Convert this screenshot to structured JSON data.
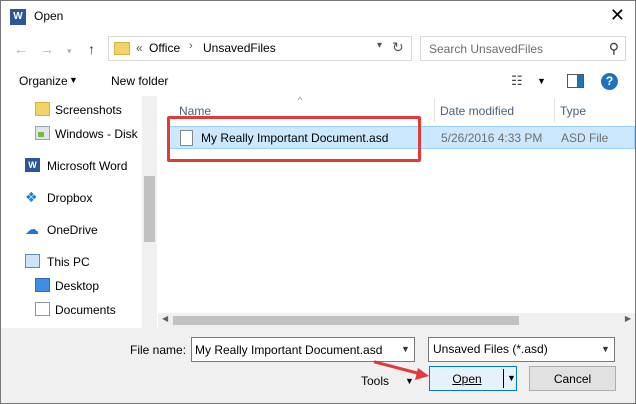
{
  "window": {
    "title": "Open",
    "app_icon": "W"
  },
  "address": {
    "chevron": "«",
    "crumbs": [
      "Office",
      "UnsavedFiles"
    ],
    "separator": "›"
  },
  "search": {
    "placeholder": "Search UnsavedFiles"
  },
  "toolbar": {
    "organize_label": "Organize",
    "new_folder_label": "New folder",
    "help": "?"
  },
  "sidebar": {
    "items": [
      {
        "label": "Screenshots",
        "icon": "folder-icon"
      },
      {
        "label": "Windows - Disk",
        "icon": "disk-icon"
      },
      {
        "label": "Microsoft Word",
        "icon": "word-icon"
      },
      {
        "label": "Dropbox",
        "icon": "dropbox-icon"
      },
      {
        "label": "OneDrive",
        "icon": "onedrive-icon"
      },
      {
        "label": "This PC",
        "icon": "computer-icon"
      },
      {
        "label": "Desktop",
        "icon": "desktop-icon"
      },
      {
        "label": "Documents",
        "icon": "documents-icon"
      }
    ]
  },
  "filelist": {
    "columns": [
      "Name",
      "Date modified",
      "Type"
    ],
    "rows": [
      {
        "name": "My Really Important Document.asd",
        "date": "5/26/2016 4:33 PM",
        "type": "ASD File"
      }
    ]
  },
  "bottom": {
    "filename_label": "File name:",
    "filename_value": "My Really Important Document.asd",
    "filetype_value": "Unsaved Files (*.asd)",
    "tools_label": "Tools",
    "open_label": "Open",
    "cancel_label": "Cancel"
  },
  "colors": {
    "accent": "#0078d7",
    "selection": "#cce8ff",
    "annotation_red": "#e03a3a"
  }
}
